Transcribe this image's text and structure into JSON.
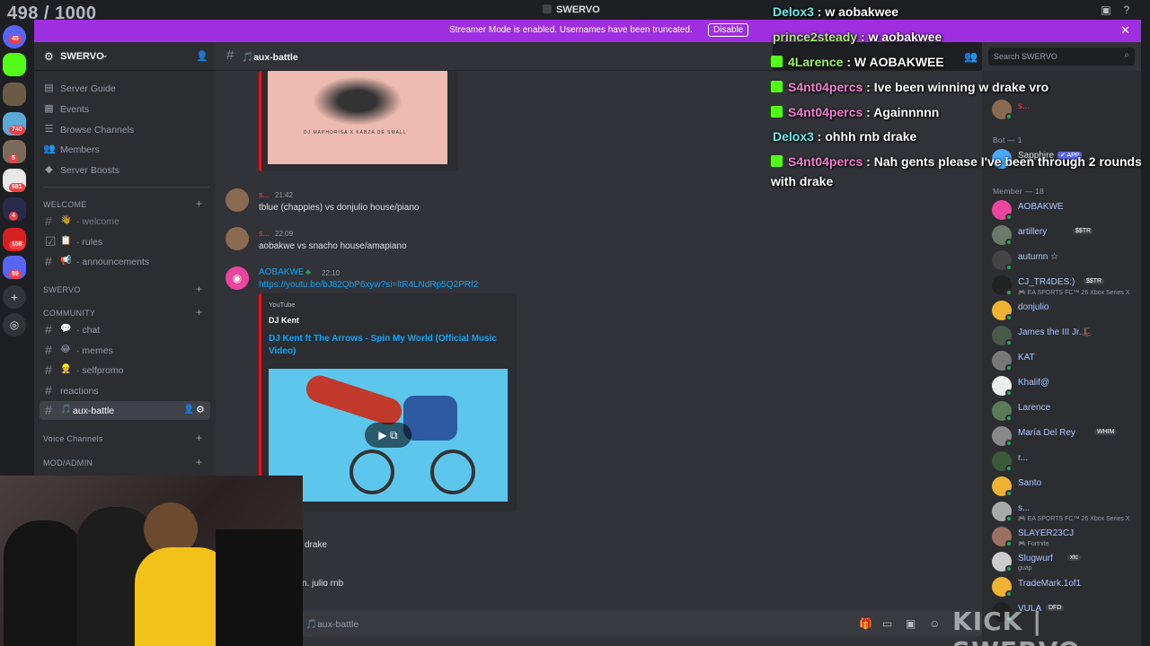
{
  "app": {
    "title": "SWERVO",
    "viewer_count": "498 / 1000"
  },
  "banner": {
    "message": "Streamer Mode is enabled. Usernames have been truncated.",
    "disable_label": "Disable"
  },
  "server_rail": {
    "badges": [
      "45",
      "740",
      "5",
      "681",
      "4",
      "108",
      "89"
    ]
  },
  "sidebar": {
    "server_name": "SWERVO",
    "nav": [
      {
        "icon": "server-guide-icon",
        "label": "Server Guide"
      },
      {
        "icon": "calendar-icon",
        "label": "Events"
      },
      {
        "icon": "browse-channels-icon",
        "label": "Browse Channels"
      },
      {
        "icon": "members-icon",
        "label": "Members"
      },
      {
        "icon": "boost-icon",
        "label": "Server Boosts"
      }
    ],
    "categories": {
      "welcome": "WELCOME",
      "swervo": "SWERVO",
      "community": "COMMUNITY",
      "voice": "Voice Channels",
      "mod": "MOD/ADMIN"
    },
    "welcome_channels": [
      {
        "emoji": "👋",
        "label": "· welcome"
      },
      {
        "emoji": "📋",
        "label": "· rules"
      },
      {
        "emoji": "📢",
        "label": "· announcements"
      }
    ],
    "community_channels": [
      {
        "emoji": "💬",
        "label": "· chat"
      },
      {
        "emoji": "😂",
        "label": "· memes"
      },
      {
        "emoji": "👷",
        "label": "· selfpromo"
      },
      {
        "emoji": "",
        "label": "reactions"
      },
      {
        "emoji": "🎵",
        "label": "aux-battle"
      }
    ]
  },
  "chat": {
    "channel_name": "🎵aux-battle",
    "messages": [
      {
        "user": "s...",
        "time": "21:42",
        "text": "tblue (chappies) vs donjulio house/piano"
      },
      {
        "user": "s...",
        "time": "22:09",
        "text": "aobakwe vs snacho house/amapiano"
      },
      {
        "user": "AOBAKWE",
        "time": "22:10",
        "link": "https://youtu.be/bJ82QbP6xyw?si=ltR4LNdRp5Q2PRf2"
      }
    ],
    "embed": {
      "provider": "YouTube",
      "author": "DJ Kent",
      "title": "DJ Kent ft The Arrows - Spin My World (Official Music Video)"
    },
    "top_embed_caption": "DJ MAPHORISA X KABZA DE SMALL",
    "partial_lines": [
      "drake",
      "n. julio rnb"
    ],
    "composer_placeholder": "🎵aux-battle"
  },
  "overlay_chat": [
    {
      "user": "Delox3",
      "text": " : w aobakwee",
      "color": "#5ef0f0",
      "badge": false
    },
    {
      "user": "prince2steady",
      "text": " : w aobakwee",
      "color": "#9ef25e",
      "badge": false
    },
    {
      "user": "4Larence",
      "text": " : W AOBAKWEE",
      "color": "#9ef25e",
      "badge": true
    },
    {
      "user": "S4nt04percs",
      "text": " : Ive been winning w drake vro",
      "color": "#f27ed0",
      "badge": true
    },
    {
      "user": "S4nt04percs",
      "text": " : Againnnnn",
      "color": "#f27ed0",
      "badge": true
    },
    {
      "user": "Delox3",
      "text": " : ohhh rnb drake",
      "color": "#5ef0f0",
      "badge": false
    },
    {
      "user": "S4nt04percs",
      "text": " : Nah gents please I've been through 2 rounds",
      "color": "#f27ed0",
      "badge": true
    }
  ],
  "overlay_wrap": "with drake",
  "members": {
    "search_placeholder": "Search SWERVO",
    "top_user": "s...",
    "bot_header": "Bot — 1",
    "bot": {
      "name": "Sapphire",
      "tag": "✔ APP"
    },
    "member_header": "Member — 18",
    "list": [
      {
        "name": "AOBAKWE",
        "sub": "",
        "tag": ""
      },
      {
        "name": "artillery",
        "sub": "",
        "tag": "$$TR"
      },
      {
        "name": "autumn ☆",
        "sub": "",
        "tag": ""
      },
      {
        "name": "CJ_TR4DES:)",
        "sub": "🎮 EA SPORTS FC™ 26 Xbox Series X",
        "tag": "$$TR"
      },
      {
        "name": "donjulio",
        "sub": "",
        "tag": ""
      },
      {
        "name": "James the III Jr.🎩",
        "sub": "",
        "tag": ""
      },
      {
        "name": "KAT",
        "sub": "",
        "tag": ""
      },
      {
        "name": "Khalif@",
        "sub": "",
        "tag": ""
      },
      {
        "name": "Larence",
        "sub": "",
        "tag": ""
      },
      {
        "name": "María Del Rey",
        "sub": "",
        "tag": "WHIM"
      },
      {
        "name": "r...",
        "sub": "",
        "tag": ""
      },
      {
        "name": "Santo",
        "sub": "",
        "tag": ""
      },
      {
        "name": "s...",
        "sub": "🎮 EA SPORTS FC™ 26 Xbox Series X",
        "tag": ""
      },
      {
        "name": "SLAYER23CJ",
        "sub": "🎮 Fortnite",
        "tag": ""
      },
      {
        "name": "Slugwurf",
        "sub": "guap",
        "tag": "xtc"
      },
      {
        "name": "TradeMark.1of1",
        "sub": "",
        "tag": ""
      },
      {
        "name": "VULA",
        "sub": "",
        "tag": "DFD"
      }
    ]
  },
  "watermark": "KICK | SWERVO",
  "colors": {
    "banner": "#9e2ee0",
    "accent_link": "#00a8fc",
    "username_red": "#f23f43",
    "online": "#23a55a",
    "kick_green": "#53fc18"
  }
}
